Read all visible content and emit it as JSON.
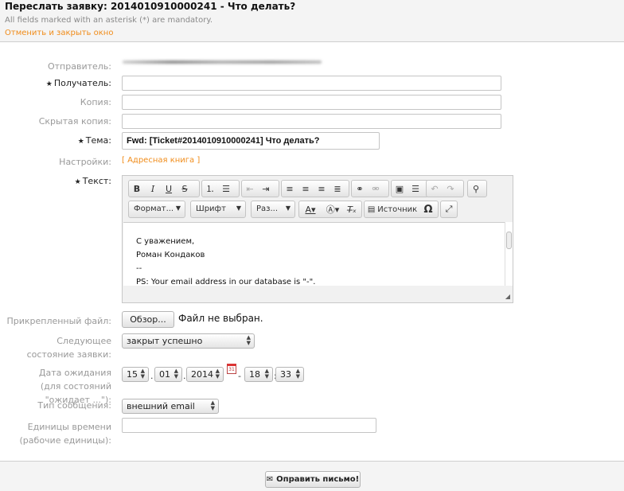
{
  "header": {
    "title": "Переслать заявку: 2014010910000241 - Что делать?",
    "mandatory_note": "All fields marked with an asterisk (*) are mandatory.",
    "cancel_link": "Отменить и закрыть окно"
  },
  "form": {
    "sender_label": "Отправитель:",
    "recipient_label": "Получатель:",
    "cc_label": "Копия:",
    "bcc_label": "Скрытая копия:",
    "subject_label": "Тема:",
    "subject_value": "Fwd: [Ticket#2014010910000241] Что делать?",
    "options_label": "Настройки:",
    "address_book_link": "[ Адресная книга ]",
    "text_label": "Текст:",
    "required_mark": "★"
  },
  "editor": {
    "toolbar_icons": [
      "bold-icon",
      "italic-icon",
      "underline-icon",
      "strikethrough-icon",
      "numbered-list-icon",
      "bulleted-list-icon",
      "outdent-icon",
      "indent-icon",
      "align-left-icon",
      "align-center-icon",
      "align-right-icon",
      "justify-icon",
      "link-icon",
      "unlink-icon",
      "image-icon",
      "horizontal-rule-icon",
      "undo-icon",
      "redo-icon",
      "find-icon"
    ],
    "format_combo": "Формат...",
    "font_combo": "Шрифт",
    "size_combo": "Раз...",
    "source_button": "Источник",
    "special_char_glyph": "Ω",
    "lines": [
      "С уважением,",
      "Роман Кондаков",
      "--",
      "PS: Your email address in our database is \"-\"."
    ]
  },
  "attachment": {
    "label": "Прикрепленный файл:",
    "browse_button": "Обзор...",
    "status": "Файл не выбран."
  },
  "next_state": {
    "label": "Следующее состояние заявки:",
    "value": "закрыт успешно"
  },
  "pending_date": {
    "label": "Дата ожидания (для состояний \"ожидает ...\"):",
    "day": "15",
    "month": "01",
    "year": "2014",
    "hour": "18",
    "minute": "33",
    "calendar_text": "31"
  },
  "message_type": {
    "label": "Тип сообщения:",
    "value": "внешний email"
  },
  "time_units": {
    "label": "Единицы времени (рабочие единицы):",
    "value": ""
  },
  "footer": {
    "send_button": "Оправить письмо!"
  },
  "colors": {
    "link_orange": "#f08c1a",
    "label_gray": "#999999"
  }
}
